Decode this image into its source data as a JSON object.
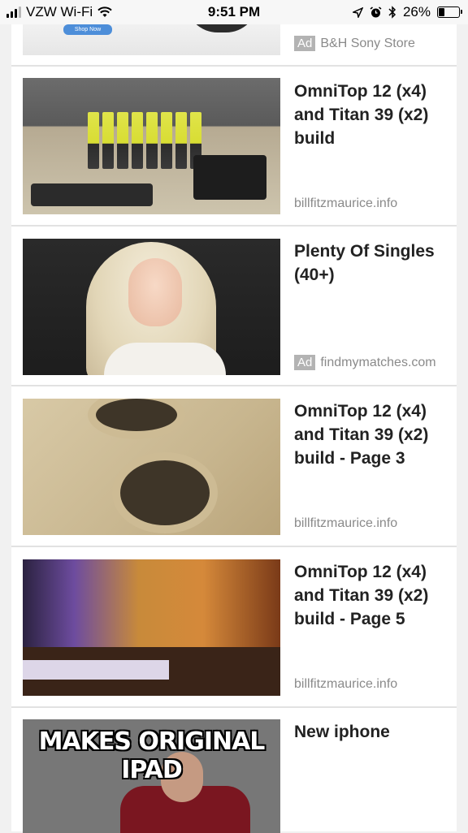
{
  "status_bar": {
    "carrier": "VZW Wi-Fi",
    "time": "9:51 PM",
    "battery": "26%",
    "battery_level": 0.26
  },
  "cards": [
    {
      "title": "",
      "ad": true,
      "ad_label": "Ad",
      "source": "B&H Sony Store",
      "thumb_text": "Shop Now"
    },
    {
      "title": "OmniTop 12 (x4) and Titan 39 (x2) build",
      "ad": false,
      "source": "billfitzmaurice.info"
    },
    {
      "title": "Plenty Of Singles (40+)",
      "ad": true,
      "ad_label": "Ad",
      "source": "findmymatches.com"
    },
    {
      "title": "OmniTop 12 (x4) and Titan 39 (x2) build - Page 3",
      "ad": false,
      "source": "billfitzmaurice.info"
    },
    {
      "title": "OmniTop 12 (x4) and Titan 39 (x2) build - Page 5",
      "ad": false,
      "source": "billfitzmaurice.info"
    },
    {
      "title": "New iphone",
      "ad": false,
      "source": "",
      "thumb_text": "MAKES ORIGINAL IPAD"
    }
  ]
}
